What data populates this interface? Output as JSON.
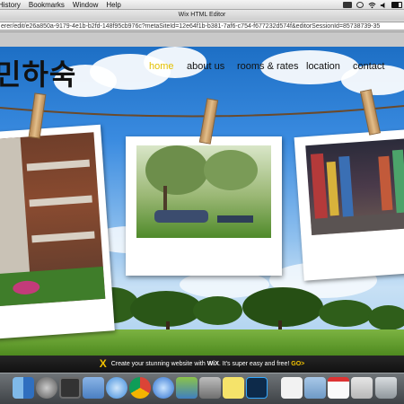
{
  "menubar": {
    "items": [
      "History",
      "Bookmarks",
      "Window",
      "Help"
    ],
    "tray_icons": [
      "wifi-icon",
      "volume-icon",
      "battery-icon"
    ]
  },
  "window": {
    "title": "Wix HTML Editor",
    "url": "erer/edit/e26a850a-9179-4e1b-b2fd-148f95cb976c?metaSiteId=12e64f1b-b381-7af6-c754-f677232d574f&editorSessionId=85738739-35"
  },
  "site": {
    "logo": "민하숙",
    "nav": [
      "home",
      "about us",
      "rooms & rates",
      "location",
      "contact"
    ],
    "active_nav_color": "#e3c000",
    "photos": [
      "building-photo",
      "park-picnic-photo",
      "city-street-night-photo"
    ]
  },
  "wix_banner": {
    "prefix": "Create your stunning website with",
    "brand": "WiX",
    "suffix": ". It's super easy and free!",
    "cta": "GO>"
  },
  "dock": {
    "apps": [
      "finder-icon",
      "system-preferences-icon",
      "mission-control-icon",
      "preview-icon",
      "safari-icon",
      "chrome-icon",
      "itunes-icon",
      "iphoto-icon",
      "disk-utility-icon",
      "stickies-icon",
      "photoshop-icon",
      "font-book-icon",
      "folder-icon",
      "calendar-icon",
      "mail-icon",
      "trash-icon"
    ]
  },
  "colors": {
    "sky": "#3a8be0",
    "banner": "#111111",
    "accent": "#f2c200"
  }
}
